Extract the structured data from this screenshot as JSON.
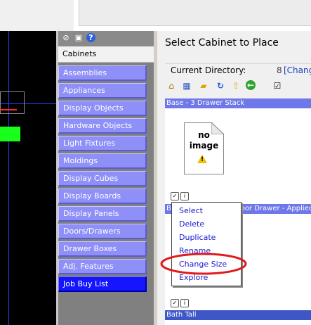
{
  "library": {
    "tab_label": "Cabinets",
    "items": [
      {
        "label": "Assemblies"
      },
      {
        "label": "Appliances"
      },
      {
        "label": "Display Objects"
      },
      {
        "label": "Hardware Objects"
      },
      {
        "label": "Light Fixtures"
      },
      {
        "label": "Moldings"
      },
      {
        "label": "Display Cubes"
      },
      {
        "label": "Display Boards"
      },
      {
        "label": "Display Panels"
      },
      {
        "label": "Doors/Drawers"
      },
      {
        "label": "Drawer Boxes"
      },
      {
        "label": "Adj. Features"
      },
      {
        "label": "Job Buy List"
      }
    ],
    "active_item": "Job Buy List",
    "toolbar_icons": [
      "pin-icon",
      "window-icon",
      "help-icon"
    ]
  },
  "panel": {
    "title": "Select Cabinet to Place",
    "current_directory_label": "Current Directory:",
    "directory_count": "8",
    "change_link": "[Chang",
    "toolbar_icons": [
      "home-icon",
      "grid-icon",
      "folder-icon",
      "refresh-icon",
      "up-folder-icon",
      "back-arrow-icon",
      "checklist-icon"
    ]
  },
  "cabinets": [
    {
      "name": "Base - 3 Drawer Stack",
      "image_text": "no\nimage"
    },
    {
      "name": "B",
      "suffix": "Door Drawer - Applied"
    },
    {
      "name": "Bath Tall"
    }
  ],
  "no_image_text": {
    "line1": "no",
    "line2": "image"
  },
  "context_menu": {
    "items": [
      {
        "label": "Select"
      },
      {
        "label": "Delete"
      },
      {
        "label": "Duplicate"
      },
      {
        "label": "Rename"
      },
      {
        "label": "Change Size"
      },
      {
        "label": "Explore"
      }
    ],
    "highlighted": "Change Size",
    "highlight_color": "#e0191e"
  },
  "colors": {
    "library_item": "#8f8ff8",
    "library_active": "#1515ff",
    "cabinet_header": "#6e78e8",
    "green_object": "#19ff1c",
    "axis_line": "#2a3cff",
    "red_line": "#ff2a2a"
  }
}
